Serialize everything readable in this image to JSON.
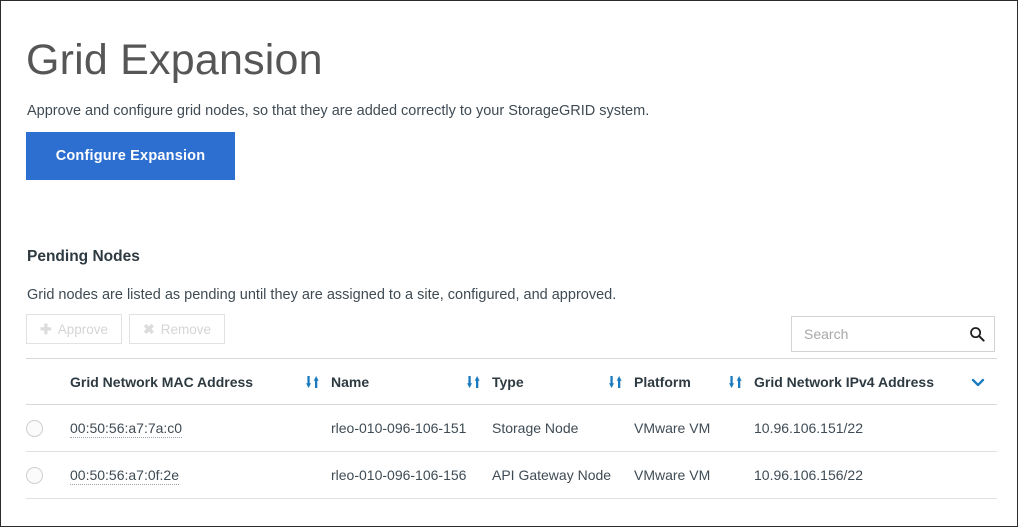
{
  "page": {
    "title": "Grid Expansion",
    "intro": "Approve and configure grid nodes, so that they are added correctly to your StorageGRID system.",
    "primary_button": "Configure Expansion",
    "accent_color": "#2d6fd1"
  },
  "pending": {
    "heading": "Pending Nodes",
    "description": "Grid nodes are listed as pending until they are assigned to a site, configured, and approved.",
    "actions": [
      {
        "label": "Approve",
        "icon": "plus-icon",
        "disabled": true
      },
      {
        "label": "Remove",
        "icon": "cross-icon",
        "disabled": true
      }
    ],
    "search": {
      "placeholder": "Search",
      "value": "",
      "icon": "search-icon"
    },
    "table": {
      "columns": [
        {
          "key": "select",
          "label": "",
          "sort": "none"
        },
        {
          "key": "mac",
          "label": "Grid Network MAC Address",
          "sort": "sortable"
        },
        {
          "key": "name",
          "label": "Name",
          "sort": "sortable"
        },
        {
          "key": "type",
          "label": "Type",
          "sort": "sortable"
        },
        {
          "key": "platform",
          "label": "Platform",
          "sort": "sortable"
        },
        {
          "key": "ip",
          "label": "Grid Network IPv4 Address",
          "sort": "desc"
        }
      ],
      "rows": [
        {
          "selected": false,
          "mac": "00:50:56:a7:7a:c0",
          "name": "rleo-010-096-106-151",
          "type": "Storage Node",
          "platform": "VMware VM",
          "ip": "10.96.106.151/22"
        },
        {
          "selected": false,
          "mac": "00:50:56:a7:0f:2e",
          "name": "rleo-010-096-106-156",
          "type": "API Gateway Node",
          "platform": "VMware VM",
          "ip": "10.96.106.156/22"
        }
      ]
    }
  }
}
